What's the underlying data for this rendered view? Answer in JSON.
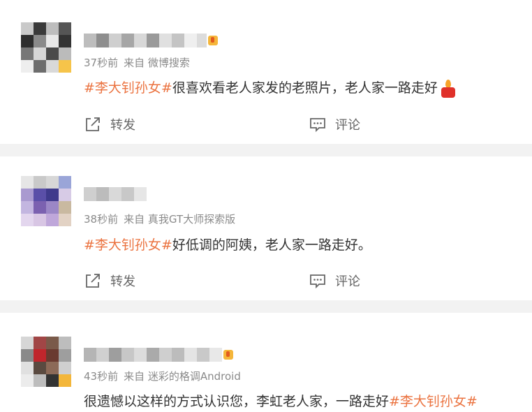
{
  "posts": [
    {
      "time": "37秒前",
      "source": "来自 微博搜索",
      "hashtag": "#李大钊孙女#",
      "body": "很喜欢看老人家发的老照片，老人家一路走好",
      "repost_label": "转发",
      "comment_label": "评论"
    },
    {
      "time": "38秒前",
      "source": "来自 真我GT大师探索版",
      "hashtag": "#李大钊孙女#",
      "body": "好低调的阿姨，老人家一路走好。",
      "repost_label": "转发",
      "comment_label": "评论"
    },
    {
      "time": "43秒前",
      "source": "来自 迷彩的格调Android",
      "hashtag": "#李大钊孙女#",
      "body": "很遗憾以这样的方式认识您，李虹老人家，一路走好"
    }
  ],
  "colors": {
    "hashtag": "#eb7340",
    "meta": "#8a8a8a",
    "text": "#333333",
    "background": "#f2f2f2"
  },
  "icons": [
    "repost-icon",
    "comment-icon",
    "candle-icon",
    "vip-badge-icon"
  ]
}
